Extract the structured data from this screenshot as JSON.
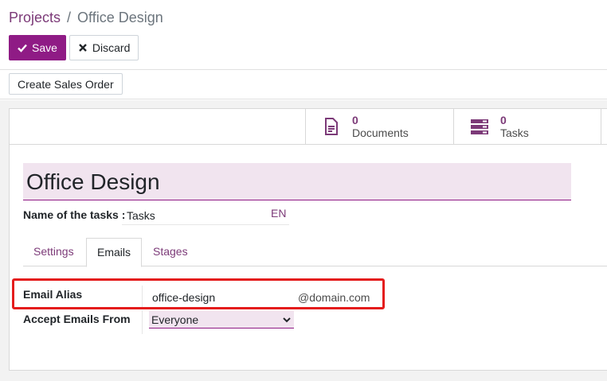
{
  "breadcrumb": {
    "parent": "Projects",
    "separator": "/",
    "current": "Office Design"
  },
  "toolbar": {
    "save_label": "Save",
    "discard_label": "Discard"
  },
  "statusbar": {
    "create_sales_order_label": "Create Sales Order"
  },
  "stat_buttons": [
    {
      "value": "0",
      "label": "Documents",
      "icon": "document-icon"
    },
    {
      "value": "0",
      "label": "Tasks",
      "icon": "tasks-icon"
    }
  ],
  "form": {
    "title": "Office Design",
    "tasks_label": "Name of the tasks :",
    "tasks_value": "Tasks",
    "lang_tag": "EN"
  },
  "tabs": [
    {
      "label": "Settings",
      "active": false
    },
    {
      "label": "Emails",
      "active": true
    },
    {
      "label": "Stages",
      "active": false
    }
  ],
  "emails": {
    "alias_label": "Email Alias",
    "alias_value": "office-design",
    "alias_domain": "@domain.com",
    "accept_label": "Accept Emails From",
    "accept_value": "Everyone"
  },
  "colors": {
    "accent": "#8f1b85",
    "link": "#7c3a78",
    "highlight": "#e41c1c",
    "field_bg": "#f1e4ef"
  }
}
